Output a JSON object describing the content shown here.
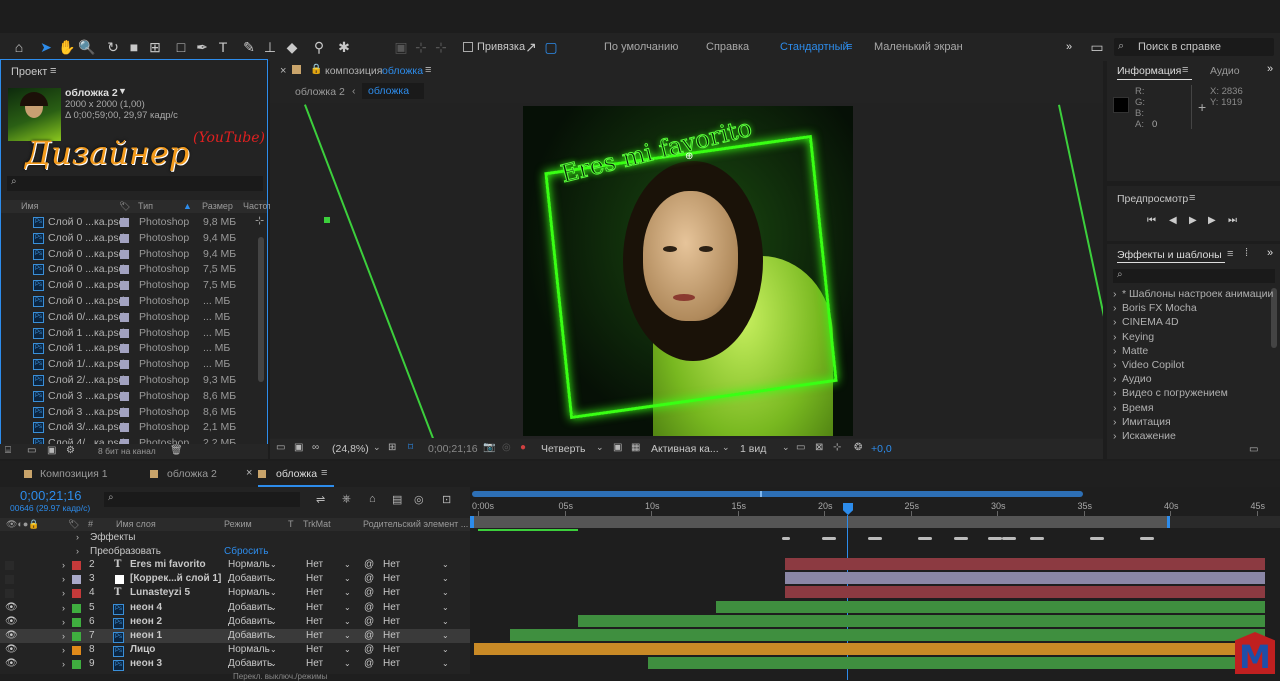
{
  "toolbar": {
    "snap_label": "Привязка"
  },
  "workspaces": [
    "По умолчанию",
    "Справка",
    "Стандартный",
    "Маленький экран"
  ],
  "search": {
    "placeholder": "Поиск в справке"
  },
  "project": {
    "tab": "Проект",
    "comp_name": "обложка 2",
    "comp_dims": "2000 x 2000 (1,00)",
    "comp_duration": "Δ 0;00;59;00, 29,97 кадр/с",
    "overlay_title": "Дизайнер",
    "overlay_sub": "(YouTube)",
    "columns": {
      "name": "Имя",
      "type": "Тип",
      "size": "Размер",
      "rate": "Частота"
    },
    "rows": [
      {
        "name": "Слой 0 ...ка.psd",
        "type": "Photoshop",
        "size": "9,8 МБ"
      },
      {
        "name": "Слой 0 ...ка.psd",
        "type": "Photoshop",
        "size": "9,4 МБ"
      },
      {
        "name": "Слой 0 ...ка.psd",
        "type": "Photoshop",
        "size": "9,4 МБ"
      },
      {
        "name": "Слой 0 ...ка.psd",
        "type": "Photoshop",
        "size": "7,5 МБ"
      },
      {
        "name": "Слой 0 ...ка.psd",
        "type": "Photoshop",
        "size": "7,5 МБ"
      },
      {
        "name": "Слой 0 ...ка.psd",
        "type": "Photoshop",
        "size": "... МБ"
      },
      {
        "name": "Слой 0/...ка.psd",
        "type": "Photoshop",
        "size": "... МБ"
      },
      {
        "name": "Слой 1 ...ка.psd",
        "type": "Photoshop",
        "size": "... МБ"
      },
      {
        "name": "Слой 1 ...ка.psd",
        "type": "Photoshop",
        "size": "... МБ"
      },
      {
        "name": "Слой 1/...ка.psd",
        "type": "Photoshop",
        "size": "... МБ"
      },
      {
        "name": "Слой 2/...ка.psd",
        "type": "Photoshop",
        "size": "9,3 МБ"
      },
      {
        "name": "Слой 3 ...ка.psd",
        "type": "Photoshop",
        "size": "8,6 МБ"
      },
      {
        "name": "Слой 3 ...ка.psd",
        "type": "Photoshop",
        "size": "8,6 МБ"
      },
      {
        "name": "Слой 3/...ка.psd",
        "type": "Photoshop",
        "size": "2,1 МБ"
      },
      {
        "name": "Слой 4/...ка.psd",
        "type": "Photoshop",
        "size": "2,2 МБ"
      }
    ],
    "bits": "8 бит на канал"
  },
  "comp": {
    "tab_prefix": "композиция",
    "tab_name": "обложка",
    "crumb1": "обложка 2",
    "crumb2": "обложка",
    "neon_text": "Eres mi favorito",
    "zoom": "(24,8%)",
    "timecode": "0;00;21;16",
    "resolution": "Четверть",
    "camera": "Активная ка...",
    "views": "1 вид",
    "exposure": "+0,0"
  },
  "info": {
    "tab": "Информация",
    "tab2": "Аудио",
    "r": "R:",
    "g": "G:",
    "b": "B:",
    "a": "A:",
    "a_val": "0",
    "x": "X: 2836",
    "y": "Y: 1919"
  },
  "preview": {
    "tab": "Предпросмотр"
  },
  "effects": {
    "tab": "Эффекты и шаблоны",
    "items": [
      "* Шаблоны настроек анимации",
      "Boris FX Mocha",
      "CINEMA 4D",
      "Keying",
      "Matte",
      "Video Copilot",
      "Аудио",
      "Видео с погружением",
      "Время",
      "Имитация",
      "Искажение"
    ]
  },
  "timeline": {
    "tabs": [
      "Композиция 1",
      "обложка 2",
      "обложка"
    ],
    "timecode": "0;00;21;16",
    "frames": "00646 (29.97 кадр/с)",
    "headers": {
      "name": "Имя слоя",
      "mode": "Режим",
      "t": "T",
      "trkmat": "TrkMat",
      "parent": "Родительский элемент ..."
    },
    "ruler": [
      "0:00s",
      "05s",
      "10s",
      "15s",
      "20s",
      "25s",
      "30s",
      "35s",
      "40s",
      "45s"
    ],
    "effects_label": "Эффекты",
    "transform_label": "Преобразовать",
    "reset_label": "Сбросить",
    "layers": [
      {
        "num": "2",
        "name": "Eres mi favorito",
        "mode": "Нормаль",
        "trk": "Нет",
        "parent": "Нет"
      },
      {
        "num": "3",
        "name": "[Коррек...й слой 1]",
        "mode": "Добавить",
        "trk": "Нет",
        "parent": "Нет"
      },
      {
        "num": "4",
        "name": "Lunasteyzi 5",
        "mode": "Нормаль",
        "trk": "Нет",
        "parent": "Нет"
      },
      {
        "num": "5",
        "name": "неон 4",
        "mode": "Добавить",
        "trk": "Нет",
        "parent": "Нет"
      },
      {
        "num": "6",
        "name": "неон 2",
        "mode": "Добавить",
        "trk": "Нет",
        "parent": "Нет"
      },
      {
        "num": "7",
        "name": "неон 1",
        "mode": "Добавить",
        "trk": "Нет",
        "parent": "Нет"
      },
      {
        "num": "8",
        "name": "Лицо",
        "mode": "Нормаль",
        "trk": "Нет",
        "parent": "Нет"
      },
      {
        "num": "9",
        "name": "неон 3",
        "mode": "Добавить",
        "trk": "Нет",
        "parent": "Нет"
      }
    ],
    "status": "Перекл. выключ./режимы"
  },
  "colors": {
    "accent": "#2d8ceb",
    "neon": "#39ff14",
    "red_bar": "#8c3a41",
    "lav_bar": "#8b87a6",
    "green_bar": "#3f8f3f",
    "orange_bar": "#c98a26"
  }
}
